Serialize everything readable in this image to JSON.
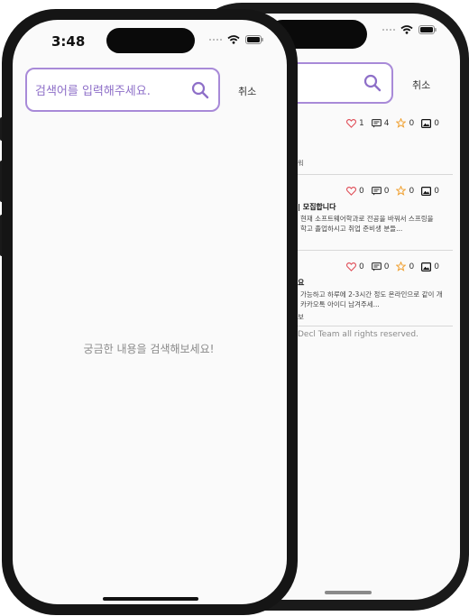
{
  "status_bar": {
    "time": "3:48"
  },
  "search": {
    "placeholder": "검색어를 입력해주세요.",
    "cancel_label": "취소",
    "empty_message": "궁금한 내용을 검색해보세요!"
  },
  "results": [
    {
      "likes": "1",
      "comments": "4",
      "favorites": "0",
      "images": "0",
      "title": "",
      "preview_lines": [],
      "meta": "워"
    },
    {
      "likes": "0",
      "comments": "0",
      "favorites": "0",
      "images": "0",
      "title": "| 모집합니다",
      "preview_lines": [
        "현재 소프트웨어학과로 전공을 바꿔서 스프링을",
        "학고 졸업하시고 취업 준비생 분들..."
      ],
      "meta": ""
    },
    {
      "likes": "0",
      "comments": "0",
      "favorites": "0",
      "images": "0",
      "title": "요",
      "preview_lines": [
        "가능하고 하루에 2-3시간 정도 온라인으로 같이 개",
        "카카오톡 아이디 남겨주세..."
      ],
      "meta": "보"
    }
  ],
  "footer": {
    "copyright": "Decl Team all rights reserved."
  },
  "colors": {
    "accent": "#a88ad8",
    "heart": "#e0505a",
    "star": "#f0a030"
  },
  "icons": [
    "search-icon",
    "wifi-icon",
    "battery-icon",
    "heart-icon",
    "comment-icon",
    "star-icon",
    "image-icon"
  ]
}
